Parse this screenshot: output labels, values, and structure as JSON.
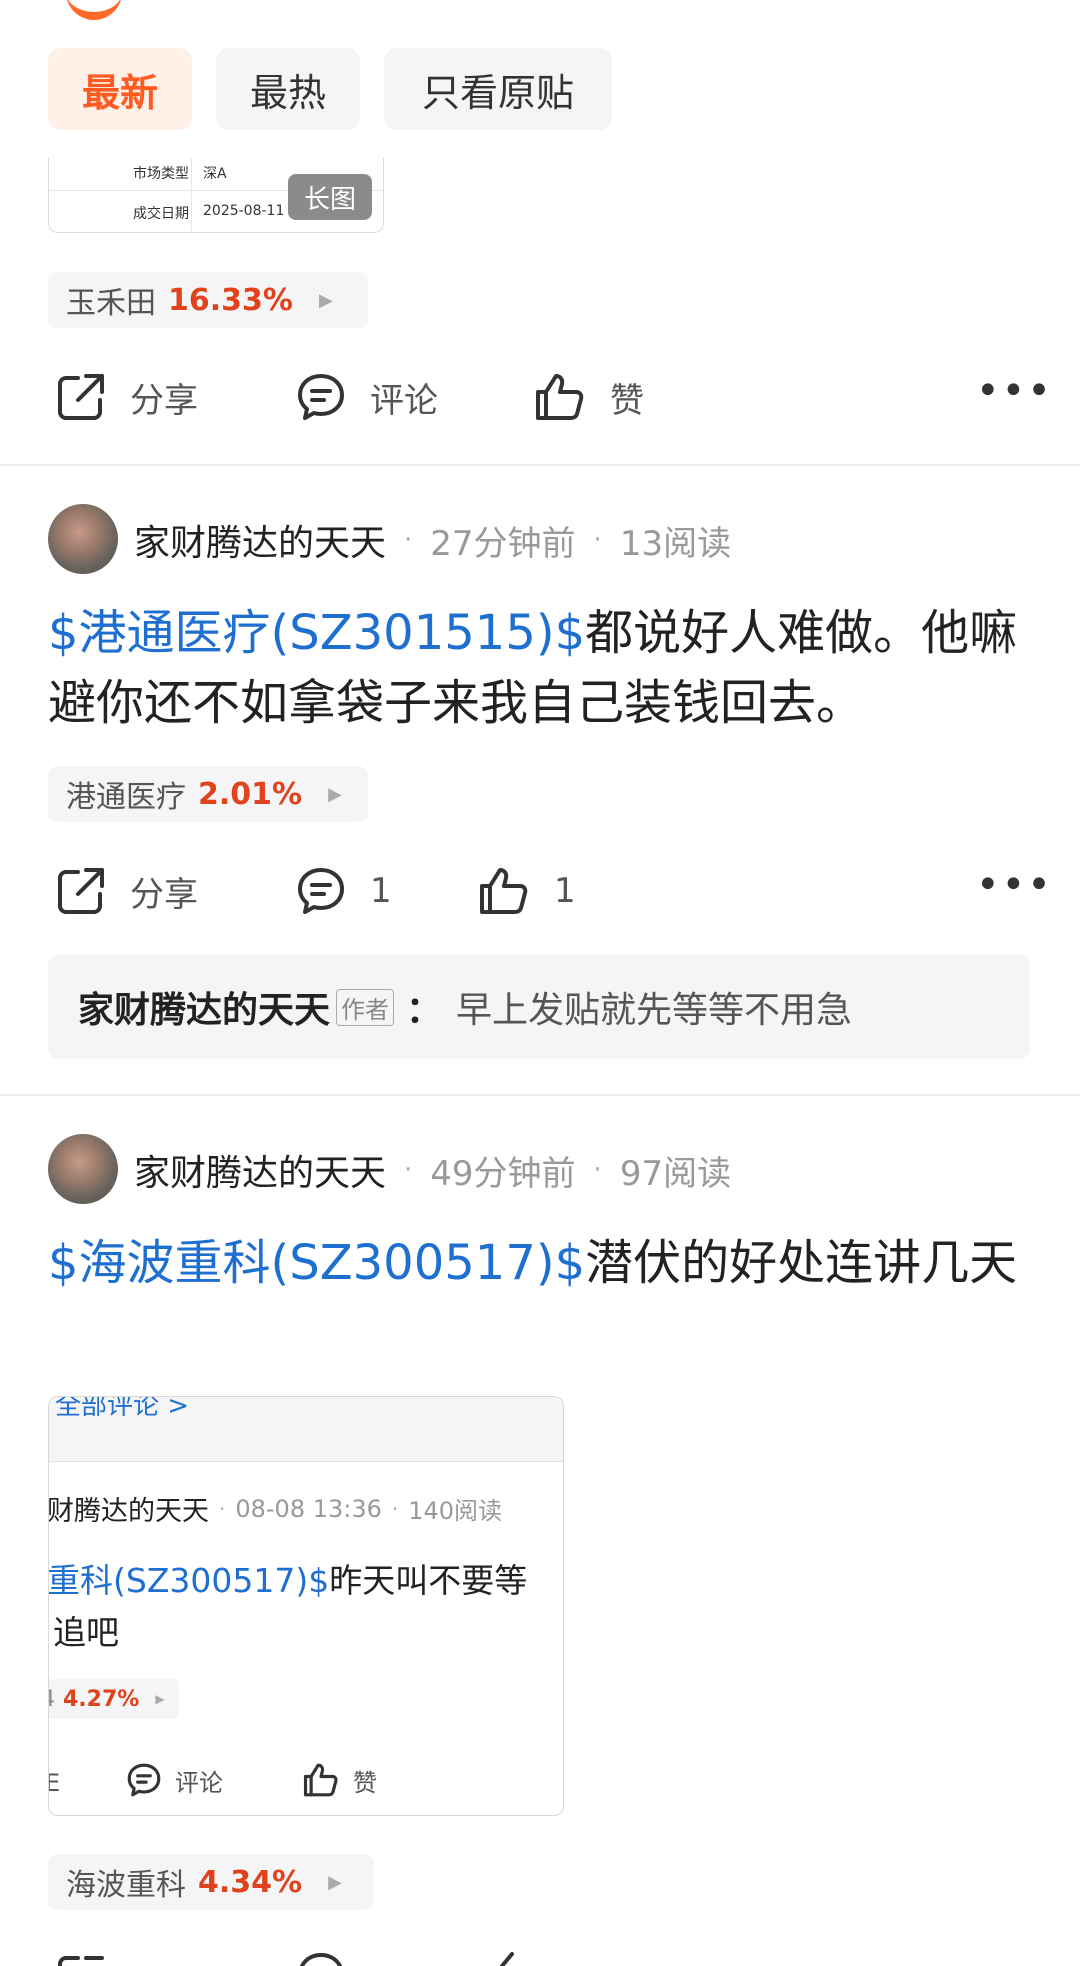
{
  "tabs": [
    {
      "label": "最新",
      "active": true
    },
    {
      "label": "最热",
      "active": false
    },
    {
      "label": "只看原贴",
      "active": false
    }
  ],
  "thumbnail1": {
    "rows": [
      {
        "key": "市场类型",
        "value": "深A"
      },
      {
        "key": "成交日期",
        "value": "2025-08-11"
      }
    ],
    "badge": "长图"
  },
  "chip1": {
    "name": "玉禾田",
    "pct": "16.33%"
  },
  "actions1": {
    "share": "分享",
    "comment": "评论",
    "like": "赞"
  },
  "post1": {
    "author": "家财腾达的天天",
    "time": "27分钟前",
    "reads": "13阅读",
    "stock_tag": "$港通医疗(SZ301515)$",
    "text": "都说好人难做。他嘛避你还不如拿袋子来我自己装钱回去。",
    "chip": {
      "name": "港通医疗",
      "pct": "2.01%"
    },
    "actions": {
      "share": "分享",
      "comment": "1",
      "like": "1"
    },
    "reply": {
      "name": "家财腾达的天天",
      "badge": "作者",
      "colon": "：",
      "text": "早上发贴就先等等不用急"
    }
  },
  "post2": {
    "author": "家财腾达的天天",
    "time": "49分钟前",
    "reads": "97阅读",
    "stock_tag": "$海波重科(SZ300517)$",
    "text": "潜伏的好处连讲几天",
    "embedded": {
      "top_link": "全部评论 >",
      "author": "财腾达的天天",
      "time": "08-08 13:36",
      "reads": "140阅读",
      "stock_tag": "重科(SZ300517)$",
      "text1": "昨天叫不要等",
      "text2": "追吧",
      "chip_pct": "4.27%",
      "comment": "评论",
      "like": "赞"
    },
    "chip": {
      "name": "海波重科",
      "pct": "4.34%"
    }
  },
  "colors": {
    "accent": "#ff5a1f",
    "stock_link": "#1f6fd1",
    "pct_red": "#e0421c"
  },
  "icons": [
    "share-icon",
    "comment-icon",
    "like-icon",
    "more-icon",
    "triangle-right-icon"
  ]
}
